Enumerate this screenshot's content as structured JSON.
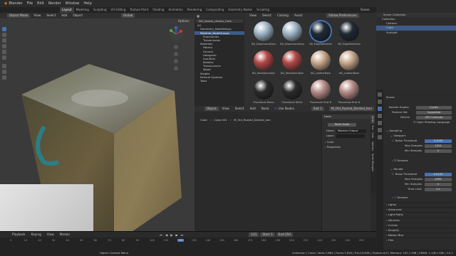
{
  "app": {
    "title": "Blender",
    "menu": [
      "File",
      "Edit",
      "Render",
      "Window",
      "Help"
    ],
    "right": {
      "scene": "Scene",
      "view_layer": "ViewLayer"
    }
  },
  "workspaces": [
    "Layout",
    "Modeling",
    "Sculpting",
    "UV Editing",
    "Texture Paint",
    "Shading",
    "Animation",
    "Rendering",
    "Compositing",
    "Geometry Nodes",
    "Scripting"
  ],
  "viewport": {
    "mode": "Object Mode",
    "menus": [
      "View",
      "Select",
      "Add",
      "Object"
    ],
    "transform": "Global",
    "options": "Options"
  },
  "asset_browser": {
    "header": [
      "View",
      "Select",
      "Catalog",
      "Asset"
    ],
    "library": "Follow Preferences",
    "library_path": "NG_Assets_Library_Core",
    "tree": [
      "All",
      "Geometry_NodeSetups",
      "Material_NodeGroups",
      "Procedurals",
      "Transmission",
      "Materials",
      "Fabrics",
      "Ground",
      "Hologram",
      "Iron/Rust",
      "Metallic",
      "Translucence",
      "Wood",
      "Models",
      "Particle Systems",
      "Tools"
    ],
    "selected_index": 2,
    "assets": [
      "NG_DispersionGlass",
      "NG_DispersionGlass",
      "NG_EdgeDetection",
      "NG_EdgeDetection",
      "NG_FakeAberration",
      "NG_FakeAberration",
      "NG_LeatherBase",
      "NG_LeatherBase",
      "Procedural Dents",
      "Procedural Dents",
      "Procedural Rust B",
      "Procedural Rust B"
    ]
  },
  "node_editor": {
    "header": [
      "Object",
      "View",
      "Select",
      "Add",
      "Node"
    ],
    "use_nodes": "Use Nodes",
    "slot": "Slot 1",
    "material": "M_Old_Rusted_Dented_Iron",
    "breadcrumb": [
      "Cube",
      "Cube.001",
      "M_Old_Rusted_Dented_Iron"
    ],
    "panel": {
      "tab": "Node",
      "title": "Node",
      "name_label": "Name:",
      "name_value": "Material Output",
      "label_label": "Label:",
      "reset": "Reset Node",
      "color": "Color",
      "properties": "Properties"
    },
    "side_tabs": [
      "Node",
      "Tool",
      "View",
      "Options",
      "Node Wrangler"
    ]
  },
  "outliner": {
    "title": "Scene Collection",
    "items": [
      "Collection",
      "Camera",
      "Cube",
      "Sunlight"
    ]
  },
  "properties": {
    "section": "Scene",
    "render_engine": {
      "label": "Render Engine",
      "value": "Cycles"
    },
    "feature_set": {
      "label": "Feature Set",
      "value": "Supported"
    },
    "device": {
      "label": "Device",
      "value": "GPU Compute"
    },
    "osl": "Open Shading Language",
    "sampling": "Sampling",
    "viewport": {
      "title": "Viewport",
      "noise_threshold": "0.1000",
      "max_samples": "1024",
      "min_samples": "0",
      "denoise": "Denoise"
    },
    "render": {
      "title": "Render",
      "noise_threshold": "0.0100",
      "max_samples": "4096",
      "min_samples": "0",
      "time_limit": "0 s",
      "denoise": "Denoise"
    },
    "labels": {
      "noise_threshold": "Noise Threshold",
      "max_samples": "Max Samples",
      "min_samples": "Min Samples",
      "time_limit": "Time Limit"
    },
    "panels": [
      "Lights",
      "Advanced",
      "Light Paths",
      "Volumes",
      "Curves",
      "Simplify",
      "Motion Blur",
      "Film"
    ]
  },
  "timeline": {
    "menus": [
      "Playback",
      "Keying",
      "View",
      "Marker"
    ],
    "frame": "121",
    "start_label": "Start",
    "start": "1",
    "end_label": "End",
    "end": "250",
    "ticks": [
      "0",
      "10",
      "20",
      "30",
      "40",
      "50",
      "60",
      "70",
      "80",
      "90",
      "100",
      "110",
      "121",
      "130",
      "140",
      "150",
      "160",
      "170",
      "180",
      "190",
      "200",
      "210",
      "220",
      "230",
      "240",
      "250"
    ]
  },
  "status": {
    "left": "Object Context Menu",
    "right": "Collection | Cube | Verts:7,864 | Faces:7,818 | Tris:15,636 | Objects:0/3 | Memory: 102.1 MiB | VRAM: 1.2/8.0 GiB | 3.0.1"
  }
}
